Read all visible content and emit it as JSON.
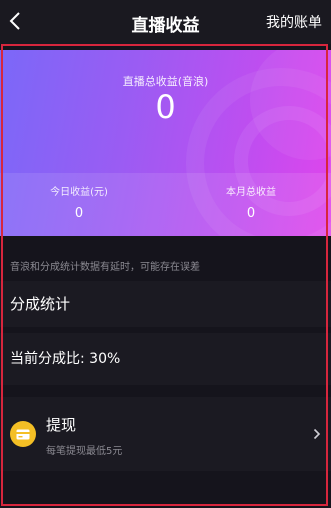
{
  "header": {
    "title": "直播收益",
    "right_link": "我的账单"
  },
  "earnings": {
    "total_label": "直播总收益(音浪)",
    "total_value": "0",
    "today_label": "今日收益(元)",
    "today_value": "0",
    "month_label": "本月总收益",
    "month_value": "0"
  },
  "notice": "音浪和分成统计数据有延时，可能存在误差",
  "sharing": {
    "section_title": "分成统计",
    "ratio_text": "当前分成比: 30%"
  },
  "withdraw": {
    "title": "提现",
    "subtitle": "每笔提现最低5元"
  },
  "colors": {
    "background": "#15141c",
    "card": "#1b1a22",
    "gradient_start": "#7b68f8",
    "gradient_end": "#e045ec",
    "coin": "#f4bf25",
    "highlight_frame": "#d7263d"
  },
  "icons": [
    "back-arrow-icon",
    "card-icon",
    "chevron-right-icon"
  ]
}
